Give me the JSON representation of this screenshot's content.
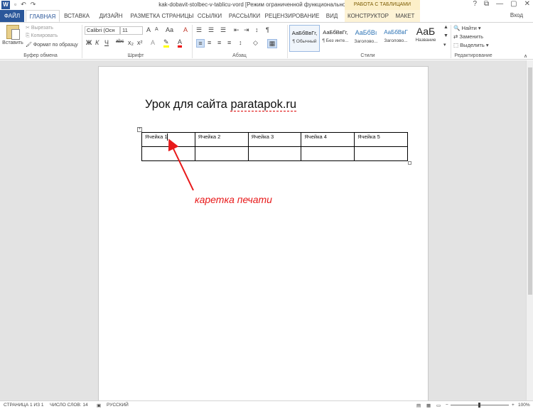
{
  "titlebar": {
    "app_icon": "W",
    "qat": {
      "undo": "↶",
      "redo": "↷",
      "save": "▫"
    },
    "window_title": "kak-dobavit-stolbec-v-tablicu-vord [Режим ограниченной функциональности] - Word",
    "controls": {
      "help": "?",
      "restore": "⧉",
      "minimize": "—",
      "maximize": "▢",
      "close": "✕"
    }
  },
  "tabs": {
    "file": "ФАЙЛ",
    "items": [
      "ГЛАВНАЯ",
      "ВСТАВКА",
      "ДИЗАЙН",
      "РАЗМЕТКА СТРАНИЦЫ",
      "ССЫЛКИ",
      "РАССЫЛКИ",
      "РЕЦЕНЗИРОВАНИЕ",
      "ВИД",
      "КОНСТРУКТОР",
      "МАКЕТ"
    ],
    "active": "ГЛАВНАЯ",
    "context_group": "РАБОТА С ТАБЛИЦАМИ",
    "signin": "Вход"
  },
  "ribbon": {
    "clipboard": {
      "paste": "Вставить",
      "cut": "Вырезать",
      "copy": "Копировать",
      "format_painter": "Формат по образцу",
      "label": "Буфер обмена"
    },
    "font": {
      "font_name": "Calibri (Осн",
      "font_size": "11",
      "bold": "Ж",
      "italic": "К",
      "underline": "Ч",
      "strikethrough": "abc",
      "subscript": "x₂",
      "superscript": "x²",
      "grow": "A",
      "shrink": "A",
      "case": "Aa",
      "clear": "A",
      "label": "Шрифт"
    },
    "paragraph": {
      "label": "Абзац",
      "pilcrow": "¶"
    },
    "styles": {
      "items": [
        {
          "sample": "АаБбВвГг,",
          "name": "¶ Обычный"
        },
        {
          "sample": "АаБбВвГг,",
          "name": "¶ Без инте..."
        },
        {
          "sample": "АаБбВı",
          "name": "Заголово..."
        },
        {
          "sample": "АаБбВвГ",
          "name": "Заголово..."
        },
        {
          "sample": "АаБ",
          "name": "Название"
        }
      ],
      "label": "Стили"
    },
    "editing": {
      "find": "Найти",
      "replace": "Заменить",
      "select": "Выделить",
      "label": "Редактирование"
    }
  },
  "document": {
    "heading_prefix": "Урок для сайта ",
    "heading_link": "paratapok.ru",
    "table": [
      [
        "Ячейка 1",
        "Ячейка 2",
        "Ячейка 3",
        "Ячейка 4",
        "Ячейка 5"
      ],
      [
        "",
        "",
        "",
        "",
        ""
      ]
    ],
    "annotation": "каретка печати",
    "annotation_color": "#e8191a"
  },
  "statusbar": {
    "page": "СТРАНИЦА 1 ИЗ 1",
    "words": "ЧИСЛО СЛОВ: 14",
    "language": "РУССКИЙ",
    "zoom": "100%",
    "zoom_minus": "−",
    "zoom_plus": "+"
  },
  "colors": {
    "accent": "#2b579a",
    "context_tab": "#fcefc8"
  }
}
